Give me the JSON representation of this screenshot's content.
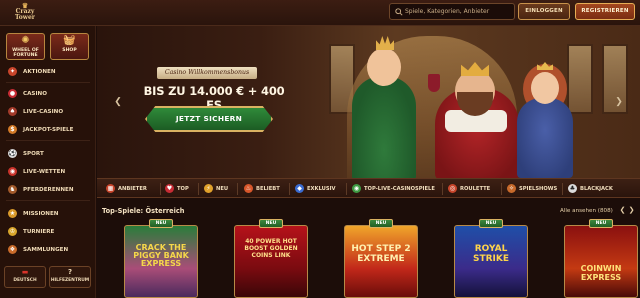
{
  "logo": {
    "text": "Crazy Tower"
  },
  "search": {
    "placeholder": "Spiele, Kategorien, Anbieter"
  },
  "header": {
    "login_label": "EINLOGGEN",
    "register_label": "REGISTRIEREN"
  },
  "sidebar": {
    "tiles": [
      {
        "label": "WHEEL OF FORTUNE",
        "icon": "wheel-icon"
      },
      {
        "label": "SHOP",
        "icon": "shop-basket-icon"
      }
    ],
    "items": [
      {
        "label": "AKTIONEN",
        "icon": "gift-icon",
        "color": "#c8452b"
      },
      {
        "label": "CASINO",
        "icon": "cherries-icon",
        "color": "#c82c35"
      },
      {
        "label": "LIVE-CASINO",
        "icon": "live-casino-icon",
        "color": "#a33b2b"
      },
      {
        "label": "JACKPOT-SPIELE",
        "icon": "jackpot-icon",
        "color": "#d37a28"
      },
      {
        "label": "SPORT",
        "icon": "soccer-ball-icon",
        "color": "#dcdcdc"
      },
      {
        "label": "LIVE-WETTEN",
        "icon": "live-bet-icon",
        "color": "#c9332b"
      },
      {
        "label": "PFERDERENNEN",
        "icon": "horse-icon",
        "color": "#a35a2b"
      },
      {
        "label": "MISSIONEN",
        "icon": "missions-icon",
        "color": "#d99a2b"
      },
      {
        "label": "TURNIERE",
        "icon": "trophy-icon",
        "color": "#d8a52b"
      },
      {
        "label": "SAMMLUNGEN",
        "icon": "collections-icon",
        "color": "#c96b2b"
      }
    ],
    "bottom": {
      "lang_label": "DEUTSCH",
      "help_label": "HILFEZENTRUM"
    }
  },
  "hero": {
    "ribbon": "Casino Willkommensbonus",
    "amount": "BIS ZU 14.000 € + 400 FS",
    "cta": "JETZT SICHERN"
  },
  "categories": [
    {
      "label": "ANBIETER",
      "icon": "provider-icon",
      "color": "#c8452b"
    },
    {
      "label": "TOP",
      "icon": "top-icon",
      "color": "#c82c35"
    },
    {
      "label": "NEU",
      "icon": "lightning-icon",
      "color": "#e0a12b"
    },
    {
      "label": "BELIEBT",
      "icon": "flame-icon",
      "color": "#d8572b"
    },
    {
      "label": "EXKLUSIV",
      "icon": "diamond-icon",
      "color": "#3a6bd1"
    },
    {
      "label": "TOP-LIVE-CASINOSPIELE",
      "icon": "live-icon",
      "color": "#3e9a42"
    },
    {
      "label": "ROULETTE",
      "icon": "roulette-icon",
      "color": "#c8452b"
    },
    {
      "label": "SPIELSHOWS",
      "icon": "spielshows-icon",
      "color": "#c86a2b"
    },
    {
      "label": "BLACKJACK",
      "icon": "cards-icon",
      "color": "#dcdcdc"
    }
  ],
  "games": {
    "heading": "Top-Spiele: Österreich",
    "all_label": "Alle ansehen (808)",
    "items": [
      {
        "title": "CRACK THE PIGGY BANK EXPRESS",
        "badge": "NEU",
        "color": "#f5d84a"
      },
      {
        "title": "40 POWER HOT BOOST GOLDEN COINS LINK",
        "badge": "NEU",
        "color": "#ffe08a"
      },
      {
        "title": "HOT STEP 2 EXTREME",
        "badge": "NEU",
        "color": "#fff2b0"
      },
      {
        "title": "ROYAL STRIKE",
        "badge": "NEU",
        "color": "#ffd54a"
      },
      {
        "title": "COINWIN EXPRESS",
        "badge": "NEU",
        "color": "#ffe27a"
      }
    ]
  }
}
